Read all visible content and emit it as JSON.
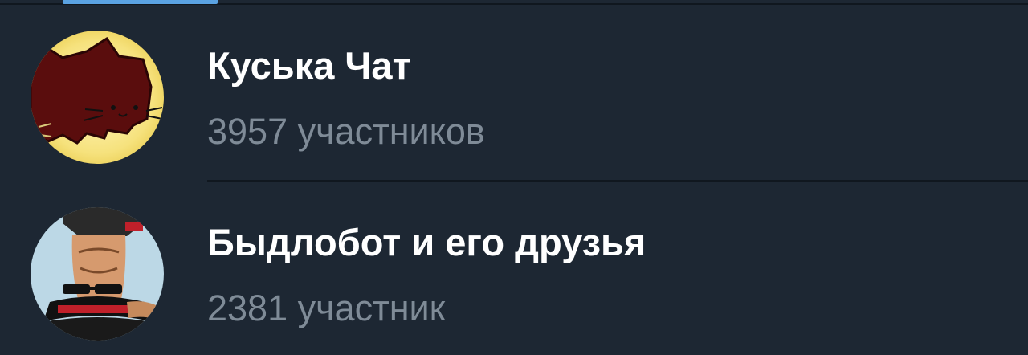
{
  "colors": {
    "background": "#1d2733",
    "tab_indicator": "#5aa2e2",
    "divider": "#10171f",
    "title_text": "#ffffff",
    "subtitle_text": "#7f8b97"
  },
  "chats": [
    {
      "title": "Куська Чат",
      "members": "3957 участников",
      "avatar_icon": "pusheen-cat-avatar"
    },
    {
      "title": "Быдлобот и его друзья",
      "members": "2381 участник",
      "avatar_icon": "cartoon-character-avatar"
    }
  ]
}
